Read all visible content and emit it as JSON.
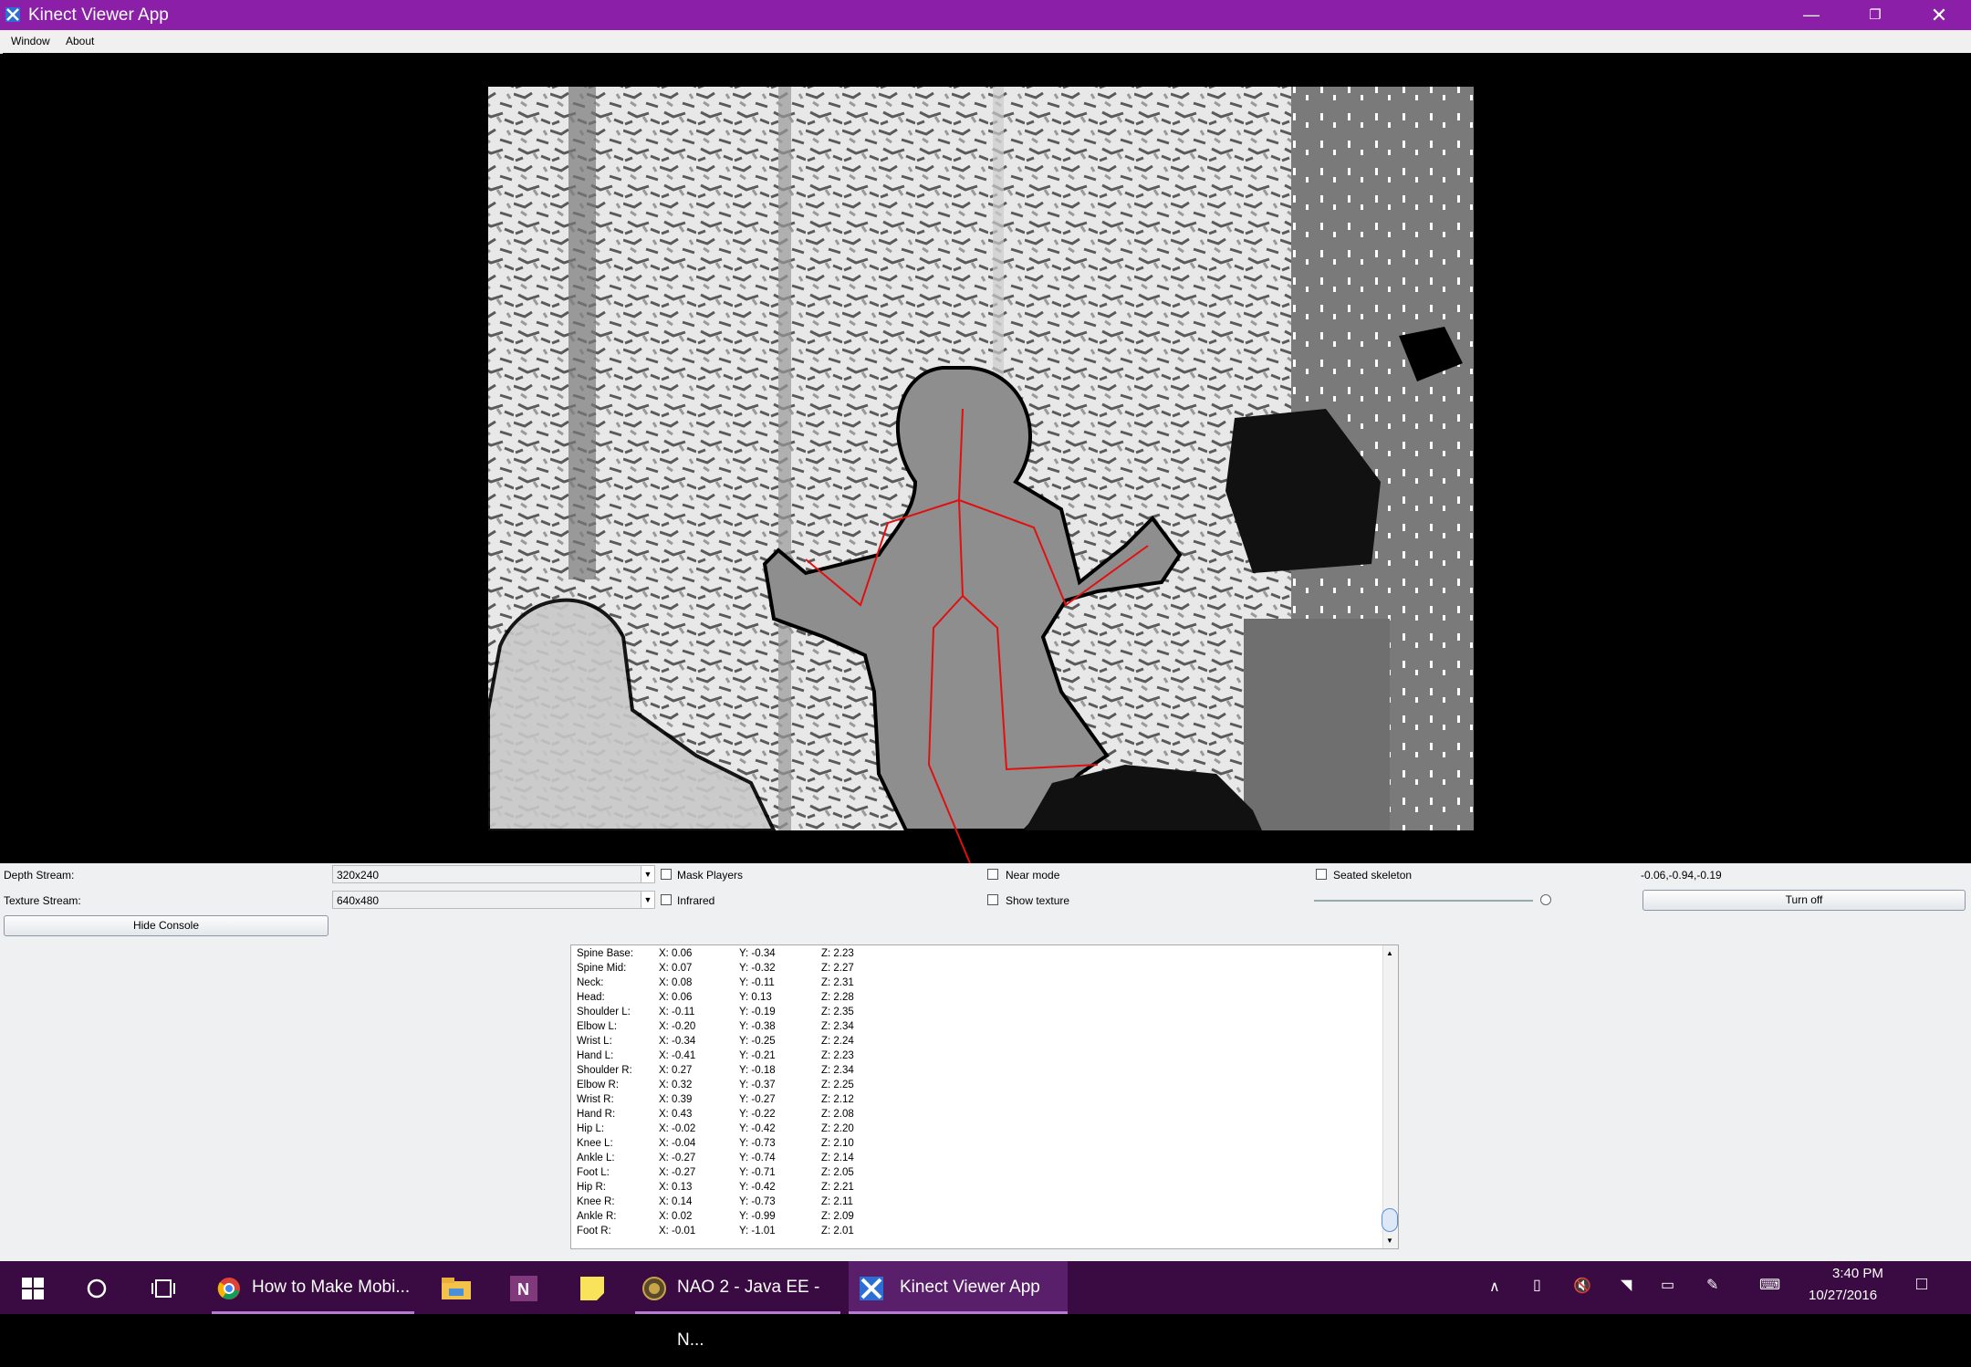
{
  "window": {
    "title": "Kinect Viewer App",
    "minimize_icon": "minimize-icon",
    "restore_icon": "restore-icon",
    "close_icon": "close-icon"
  },
  "menu": [
    "Window",
    "About"
  ],
  "controls": {
    "depth_label": "Depth Stream:",
    "depth_value": "320x240",
    "texture_label": "Texture Stream:",
    "texture_value": "640x480",
    "mask_players": "Mask Players",
    "infrared": "Infrared",
    "near_mode": "Near mode",
    "show_texture": "Show texture",
    "seated_skeleton": "Seated skeleton",
    "orientation": "-0.06,-0.94,-0.19",
    "turn_off": "Turn off",
    "hide_console": "Hide Console"
  },
  "joints": [
    [
      "Spine Base:",
      "X: 0.06",
      "Y: -0.34",
      "Z: 2.23"
    ],
    [
      "Spine Mid:",
      "X: 0.07",
      "Y: -0.32",
      "Z: 2.27"
    ],
    [
      "Neck:",
      "X: 0.08",
      "Y: -0.11",
      "Z: 2.31"
    ],
    [
      "Head:",
      "X: 0.06",
      "Y: 0.13",
      "Z: 2.28"
    ],
    [
      "Shoulder L:",
      "X: -0.11",
      "Y: -0.19",
      "Z: 2.35"
    ],
    [
      "Elbow L:",
      "X: -0.20",
      "Y: -0.38",
      "Z: 2.34"
    ],
    [
      "Wrist L:",
      "X: -0.34",
      "Y: -0.25",
      "Z: 2.24"
    ],
    [
      "Hand L:",
      "X: -0.41",
      "Y: -0.21",
      "Z: 2.23"
    ],
    [
      "Shoulder R:",
      "X: 0.27",
      "Y: -0.18",
      "Z: 2.34"
    ],
    [
      "Elbow R:",
      "X: 0.32",
      "Y: -0.37",
      "Z: 2.25"
    ],
    [
      "Wrist R:",
      "X: 0.39",
      "Y: -0.27",
      "Z: 2.12"
    ],
    [
      "Hand R:",
      "X: 0.43",
      "Y: -0.22",
      "Z: 2.08"
    ],
    [
      "Hip L:",
      "X: -0.02",
      "Y: -0.42",
      "Z: 2.20"
    ],
    [
      "Knee L:",
      "X: -0.04",
      "Y: -0.73",
      "Z: 2.10"
    ],
    [
      "Ankle L:",
      "X: -0.27",
      "Y: -0.74",
      "Z: 2.14"
    ],
    [
      "Foot L:",
      "X: -0.27",
      "Y: -0.71",
      "Z: 2.05"
    ],
    [
      "Hip R:",
      "X: 0.13",
      "Y: -0.42",
      "Z: 2.21"
    ],
    [
      "Knee R:",
      "X: 0.14",
      "Y: -0.73",
      "Z: 2.11"
    ],
    [
      "Ankle R:",
      "X: 0.02",
      "Y: -0.99",
      "Z: 2.09"
    ],
    [
      "Foot R:",
      "X: -0.01",
      "Y: -1.01",
      "Z: 2.01"
    ]
  ],
  "taskbar": {
    "items": [
      "How to Make Mobi...",
      "NAO 2 - Java EE - N...",
      "Kinect Viewer App"
    ],
    "time": "3:40 PM",
    "date": "10/27/2016"
  },
  "colors": {
    "titlebar": "#8b1fa8",
    "taskbar": "#3a0b42",
    "skeleton": "#e01010"
  }
}
